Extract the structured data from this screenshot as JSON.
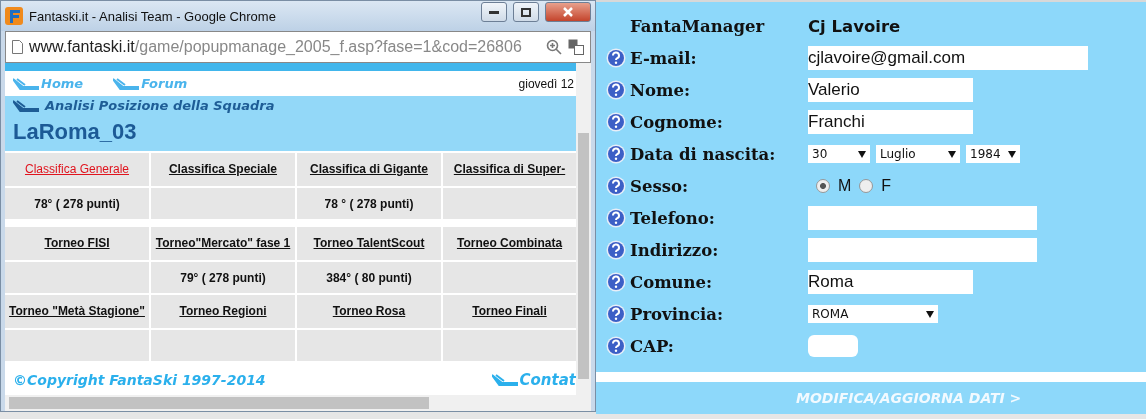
{
  "popup": {
    "title": "Fantaski.it - Analisi Team - Google Chrome",
    "address": {
      "host": "www.fantaski.it",
      "path": "/game/popupmanage_2005_f.asp?fase=1&cod=26806"
    },
    "nav": [
      {
        "label": "Home"
      },
      {
        "label": "Forum"
      }
    ],
    "date": "giovedì 12",
    "section_title": "Analisi Posizione della Squadra",
    "team": "LaRoma_03",
    "table": {
      "rows": [
        {
          "kind": "head",
          "cells": [
            {
              "kind": "link",
              "text": "Classifica Generale",
              "selected": true
            },
            {
              "kind": "link",
              "text": "Classifica Speciale",
              "selected": false
            },
            {
              "kind": "link",
              "text": "Classifica di Gigante",
              "selected": false
            },
            {
              "kind": "link",
              "text": "Classifica di Super-",
              "selected": false
            }
          ]
        },
        {
          "kind": "value",
          "cells": [
            {
              "kind": "text",
              "text": "78° ( 278 punti)"
            },
            {
              "kind": "empty"
            },
            {
              "kind": "text",
              "text": "78 ° ( 278  punti)"
            },
            {
              "kind": "empty"
            }
          ]
        },
        {
          "kind": "gap"
        },
        {
          "kind": "head",
          "cells": [
            {
              "kind": "link",
              "text": "Torneo FISI",
              "selected": false
            },
            {
              "kind": "link",
              "text": "Torneo\"Mercato\" fase 1",
              "selected": false
            },
            {
              "kind": "link",
              "text": "Torneo TalentScout",
              "selected": false
            },
            {
              "kind": "link",
              "text": "Torneo Combinata",
              "selected": false
            }
          ]
        },
        {
          "kind": "value",
          "cells": [
            {
              "kind": "empty"
            },
            {
              "kind": "text",
              "text": "79° ( 278  punti)"
            },
            {
              "kind": "text",
              "text": "384° ( 80  punti)"
            },
            {
              "kind": "empty"
            }
          ]
        },
        {
          "kind": "head",
          "cells": [
            {
              "kind": "link",
              "text": "Torneo \"Metà Stagione\"",
              "selected": false
            },
            {
              "kind": "link",
              "text": "Torneo Regioni",
              "selected": false
            },
            {
              "kind": "link",
              "text": "Torneo Rosa",
              "selected": false
            },
            {
              "kind": "link",
              "text": "Torneo Finali",
              "selected": false
            }
          ]
        },
        {
          "kind": "value",
          "cells": [
            {
              "kind": "empty"
            },
            {
              "kind": "empty"
            },
            {
              "kind": "empty"
            },
            {
              "kind": "empty"
            }
          ]
        }
      ]
    },
    "copyright": "©Copyright FantaSki 1997-2014",
    "contact": "Contat"
  },
  "form": {
    "rows": [
      {
        "kind": "header",
        "label": "FantaManager",
        "value": "Cj Lavoire"
      },
      {
        "kind": "email",
        "label": "E-mail:",
        "value": "cjlavoire@gmail.com"
      },
      {
        "kind": "text",
        "label": "Nome:",
        "value": "Valerio"
      },
      {
        "kind": "text",
        "label": "Cognome:",
        "value": "Franchi"
      },
      {
        "kind": "date",
        "label": "Data di nascita:",
        "selects": [
          "30",
          "Luglio",
          "1984"
        ]
      },
      {
        "kind": "radio",
        "label": "Sesso:",
        "options": [
          {
            "label": "M",
            "selected": true
          },
          {
            "label": "F",
            "selected": false
          }
        ]
      },
      {
        "kind": "wide",
        "label": "Telefono:"
      },
      {
        "kind": "wide",
        "label": "Indirizzo:"
      },
      {
        "kind": "text",
        "label": "Comune:",
        "value": "Roma"
      },
      {
        "kind": "select",
        "label": "Provincia:",
        "value": "ROMA"
      },
      {
        "kind": "hidden",
        "label": "CAP:"
      }
    ],
    "submit": "MODIFICA/AGGIORNA DATI >"
  }
}
